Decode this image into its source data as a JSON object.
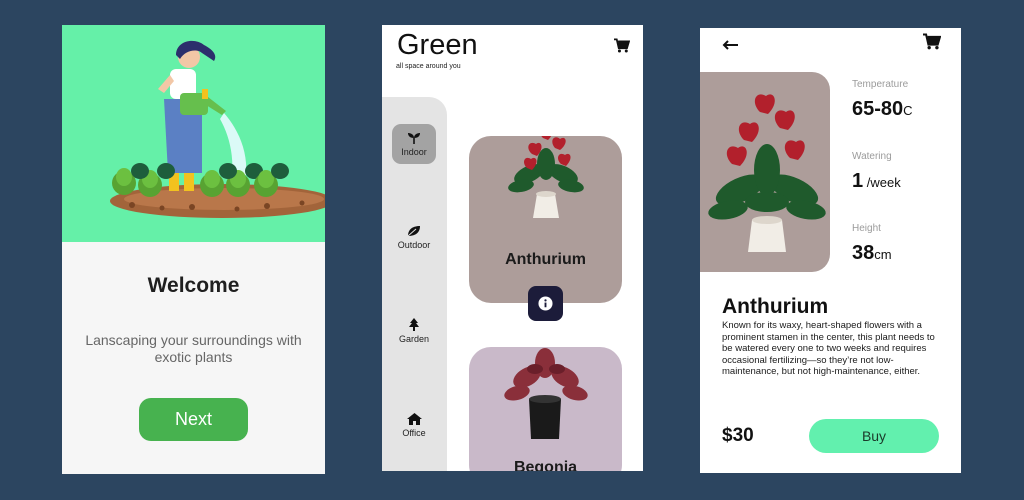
{
  "welcome": {
    "title": "Welcome",
    "subtitle": "Lanscaping your surroundings with exotic plants",
    "next_label": "Next",
    "hero_color": "#65f0a8",
    "button_color": "#47b24f"
  },
  "catalog": {
    "brand": "Green",
    "tagline": "all space around you",
    "categories": [
      {
        "label": "Indoor",
        "icon": "sprout-icon",
        "active": true
      },
      {
        "label": "Outdoor",
        "icon": "leaf-icon",
        "active": false
      },
      {
        "label": "Garden",
        "icon": "tree-icon",
        "active": false
      },
      {
        "label": "Office",
        "icon": "house-icon",
        "active": false
      }
    ],
    "products": [
      {
        "name": "Anthurium",
        "card_color": "#ad9d9a"
      },
      {
        "name": "Begonia",
        "card_color": "#c9b9c9"
      }
    ]
  },
  "detail": {
    "specs": [
      {
        "label": "Temperature",
        "value": "65-80",
        "unit": "C"
      },
      {
        "label": "Watering",
        "value": "1",
        "unit": " /week"
      },
      {
        "label": "Height",
        "value": "38",
        "unit": "cm"
      }
    ],
    "name": "Anthurium",
    "description": "Known for its waxy, heart-shaped flowers with a prominent stamen in the center, this plant needs to be watered every one to two weeks and requires occasional fertilizing—so they’re not low-maintenance, but not high-maintenance, either.",
    "price": "$30",
    "buy_label": "Buy",
    "accent": "#62f0ae"
  }
}
